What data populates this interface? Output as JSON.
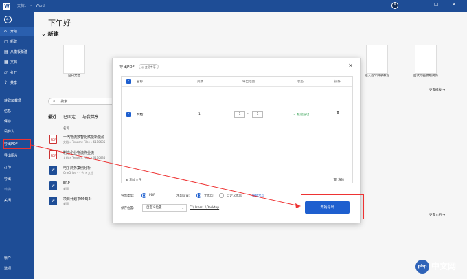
{
  "titlebar": {
    "doc_name": "文档1",
    "app_name": "Word",
    "user_initial": "A",
    "minimize": "—",
    "maximize": "☐",
    "close": "✕"
  },
  "sidebar": {
    "back": "←",
    "items": [
      {
        "label": "开始",
        "icon": "⌂"
      },
      {
        "label": "新建",
        "icon": "▢"
      },
      {
        "label": "从模板新建",
        "icon": "▤"
      },
      {
        "label": "文档",
        "icon": "▦"
      },
      {
        "label": "打开",
        "icon": "▱"
      },
      {
        "label": "共享",
        "icon": "⇪"
      }
    ],
    "plain_items": [
      "获取加载项",
      "信息",
      "保存",
      "另存为",
      "导出PDF",
      "导出图片",
      "打印",
      "导出",
      "转换",
      "关闭"
    ],
    "bottom": [
      "帐户",
      "选项"
    ]
  },
  "main": {
    "greeting": "下午好",
    "new_section": "新建",
    "templates": [
      "空白文档",
      "插入首个目录教程",
      "面试动画模版简历"
    ],
    "more_templates": "更多模板 →",
    "more_files": "更多文档 →",
    "search_placeholder": "搜索",
    "tabs": [
      "最近",
      "已固定",
      "与我共享"
    ],
    "column_name": "名称",
    "files": [
      {
        "name": "一汽物流数智化赋能新能源",
        "path": "文档 » Tencent Files » 6110635",
        "type": "pdf"
      },
      {
        "name": "制造企业物流作业流",
        "path": "文档 » Tencent Files » 6110635",
        "type": "pdf"
      },
      {
        "name": "电子商务案例分析",
        "path": "OneDrive - 个人 » 文档",
        "type": "W"
      },
      {
        "name": "ERP",
        "path": "桌面",
        "type": "W"
      },
      {
        "name": "项目计划书666(2)",
        "path": "桌面",
        "type": "W"
      }
    ]
  },
  "dialog": {
    "title": "导出PDF",
    "badge": "◎ 会员专享",
    "close": "✕",
    "headers": {
      "name": "名称",
      "pages": "页数",
      "range": "导出范围",
      "status": "状态",
      "actions": "操作"
    },
    "row": {
      "name": "文档1",
      "pages": "1",
      "from": "1",
      "dash": "-",
      "to": "1",
      "status": "✓ 校验成功",
      "delete": "🗑"
    },
    "add_file": "⊕ 添加文件",
    "clear": "🗑 清除",
    "export_type_label": "导出类型:",
    "export_type_value": "PDF",
    "watermark_label": "水印设置:",
    "watermark_none": "无水印",
    "watermark_custom": "自定义水印",
    "watermark_link": "编辑水印",
    "save_label": "保存位置:",
    "save_value": "自定义位置",
    "save_path": "C:\\Users...\\Desktop",
    "start_button": "开始导出"
  },
  "watermark_logo": {
    "circle": "php",
    "text": "中文网"
  },
  "colors": {
    "accent": "#1e5fcf",
    "sidebar": "#1e4d96",
    "annotation": "#ee3333",
    "success": "#2e9e4e"
  }
}
